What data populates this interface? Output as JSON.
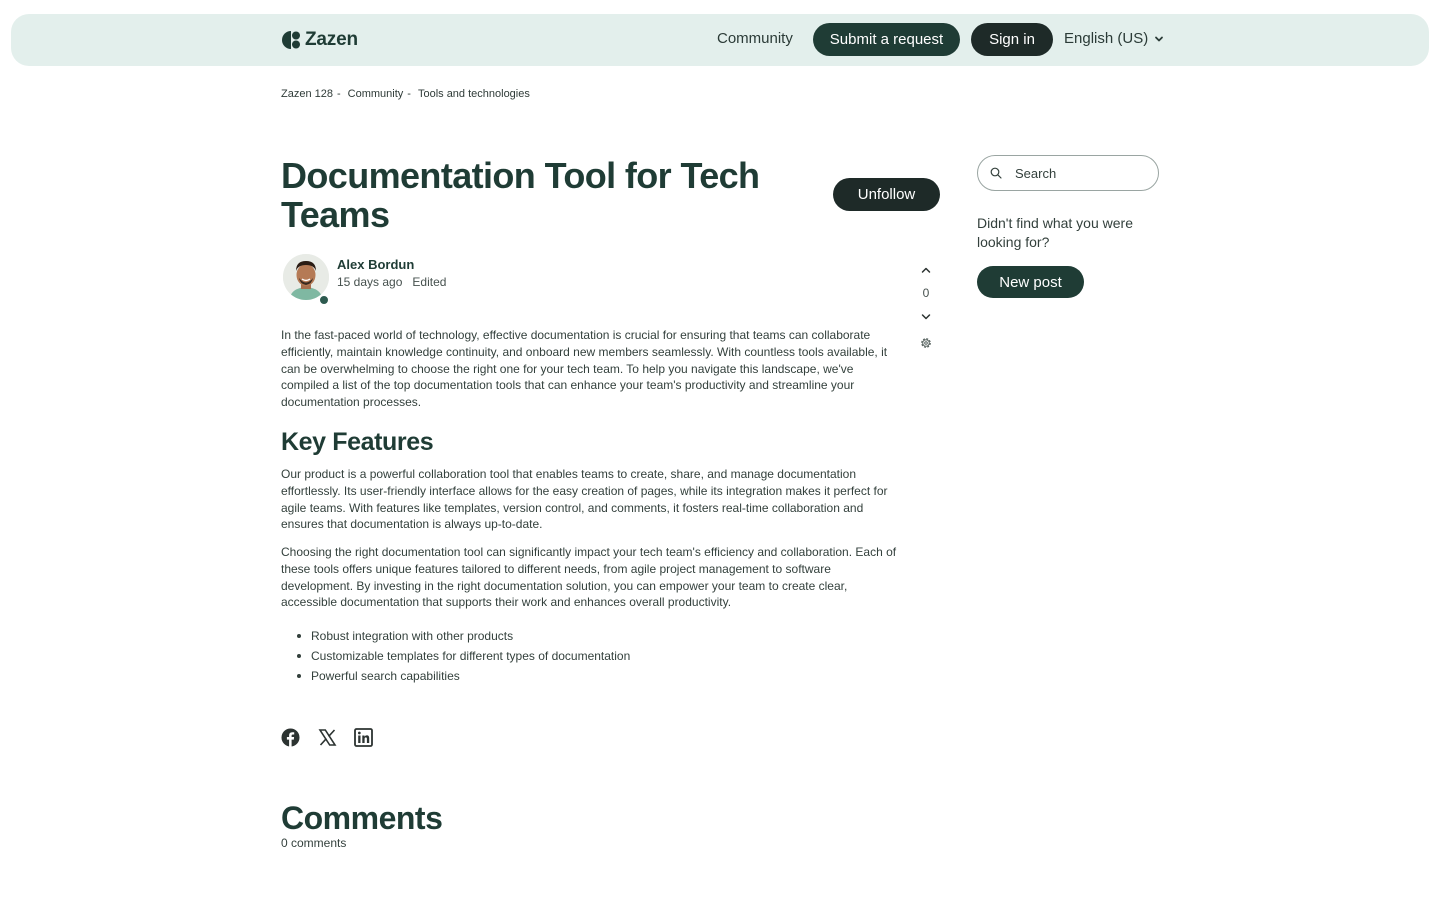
{
  "header": {
    "logo_text": "Zazen",
    "nav_community": "Community",
    "submit_request": "Submit a request",
    "sign_in": "Sign in",
    "language": "English (US)"
  },
  "breadcrumb": [
    "Zazen 128",
    "Community",
    "Tools and technologies"
  ],
  "post": {
    "title": "Documentation Tool for Tech Teams",
    "unfollow": "Unfollow",
    "author": "Alex Bordun",
    "time": "15 days ago",
    "edited": "Edited",
    "votes": "0",
    "paragraph1": "In the fast-paced world of technology, effective documentation is crucial for ensuring that teams can collaborate efficiently, maintain knowledge continuity, and onboard new members seamlessly. With countless tools available, it can be overwhelming to choose the right one for your tech team. To help you navigate this landscape, we've compiled a list of the top documentation tools that can enhance your team's productivity and streamline your documentation processes.",
    "heading": "Key Features",
    "paragraph2": "Our product is a powerful collaboration tool that enables teams to create, share, and manage documentation effortlessly. Its user-friendly interface allows for the easy creation of pages, while its integration makes it perfect for agile teams. With features like templates, version control, and comments, it fosters real-time collaboration and ensures that documentation is always up-to-date.",
    "paragraph3": "Choosing the right documentation tool can significantly impact your tech team's efficiency and collaboration. Each of these tools offers unique features tailored to different needs, from agile project management to software development. By investing in the right documentation solution, you can empower your team to create clear, accessible documentation that supports their work and enhances overall productivity.",
    "features": [
      "Robust integration with other products",
      "Customizable templates for different types of documentation",
      "Powerful search capabilities"
    ]
  },
  "comments": {
    "title": "Comments",
    "count": "0 comments"
  },
  "sidebar": {
    "search_placeholder": "Search",
    "prompt": "Didn't find what you were looking for?",
    "new_post": "New post"
  },
  "colors": {
    "header_bg": "#e3efec",
    "brand_dark": "#1f3c35",
    "button_dark": "#1e2a28"
  }
}
